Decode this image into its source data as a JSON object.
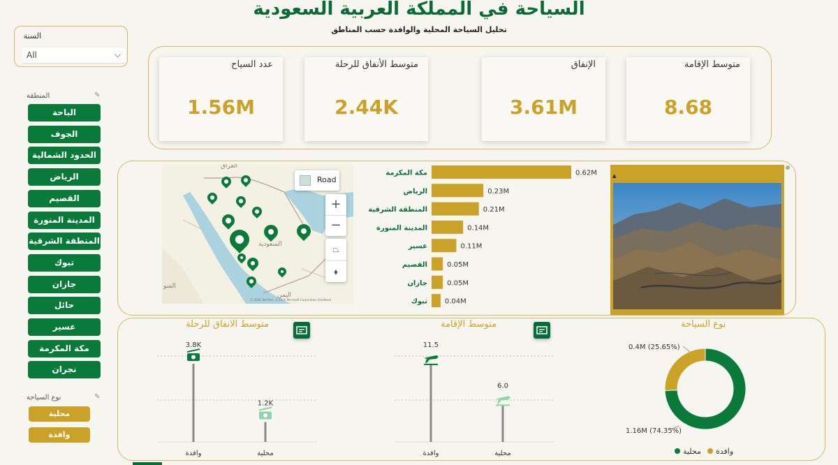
{
  "header": {
    "title": "السياحة في المملكة العربية السعودية",
    "subtitle": "تحليل السياحة المحلية والوافدة حسب المناطق"
  },
  "filters": {
    "year_label": "السنة",
    "year_value": "All",
    "region_title": "المنطقة",
    "regions": [
      "الباحة",
      "الجوف",
      "الحدود الشمالية",
      "الرياض",
      "القصيم",
      "المدينة المنورة",
      "المنطقة الشرقية",
      "تبوك",
      "جازان",
      "حائل",
      "عسير",
      "مكة المكرمة",
      "نجران"
    ],
    "type_title": "نوع السياحة",
    "types": [
      "محلية",
      "وافدة"
    ]
  },
  "kpis": [
    {
      "label": "عدد السياح",
      "value": "1.56M"
    },
    {
      "label": "متوسط الأنفاق للرحلة",
      "value": "2.44K"
    },
    {
      "label": "الإنفاق",
      "value": "3.61M"
    },
    {
      "label": "متوسط الإقامة",
      "value": "8.68"
    }
  ],
  "map": {
    "mode_label": "Road",
    "zoom_in": "+",
    "zoom_out": "−",
    "credit": "© 2026 TomTom, © 2026 Microsoft Corporation  Feedback",
    "cities": [
      "العراق",
      "السعودية",
      "اليمن",
      "السو"
    ]
  },
  "colors": {
    "green": "#0a7a3b",
    "gold": "#c9a227",
    "light_green": "#8fd4a8"
  },
  "chart_data": [
    {
      "type": "bar",
      "orientation": "horizontal",
      "categories": [
        "مكة المكرمة",
        "الرياض",
        "المنطقة الشرقية",
        "المدينة المنورة",
        "عسير",
        "القصيم",
        "جازان",
        "تبوك"
      ],
      "values": [
        0.62,
        0.23,
        0.21,
        0.14,
        0.11,
        0.05,
        0.05,
        0.04
      ],
      "value_labels": [
        "0.62M",
        "0.23M",
        "0.21M",
        "0.14M",
        "0.11M",
        "0.05M",
        "0.05M",
        "0.04M"
      ],
      "unit": "M",
      "xlim": [
        0,
        0.7
      ]
    },
    {
      "type": "bar",
      "style": "lollipop",
      "title": "متوسط الانفاق للرحلة",
      "categories": [
        "وافدة",
        "محلية"
      ],
      "values": [
        3800,
        1200
      ],
      "value_labels": [
        "3.8K",
        "1.2K"
      ],
      "ylim": [
        0,
        4300
      ]
    },
    {
      "type": "bar",
      "style": "lollipop",
      "title": "متوسط الإقامة",
      "categories": [
        "وافدة",
        "محلية"
      ],
      "values": [
        11.5,
        6.0
      ],
      "value_labels": [
        "11.5",
        "6.0"
      ],
      "ylim": [
        0,
        13
      ]
    },
    {
      "type": "pie",
      "style": "donut",
      "title": "نوع السياحة",
      "categories": [
        "محلية",
        "وافدة"
      ],
      "values": [
        1.16,
        0.4
      ],
      "value_labels": [
        "1.16M (74.35%)",
        "0.4M (25.65%)"
      ],
      "colors": [
        "#0a7a3b",
        "#c9a227"
      ],
      "legend": "bottom-right"
    }
  ]
}
